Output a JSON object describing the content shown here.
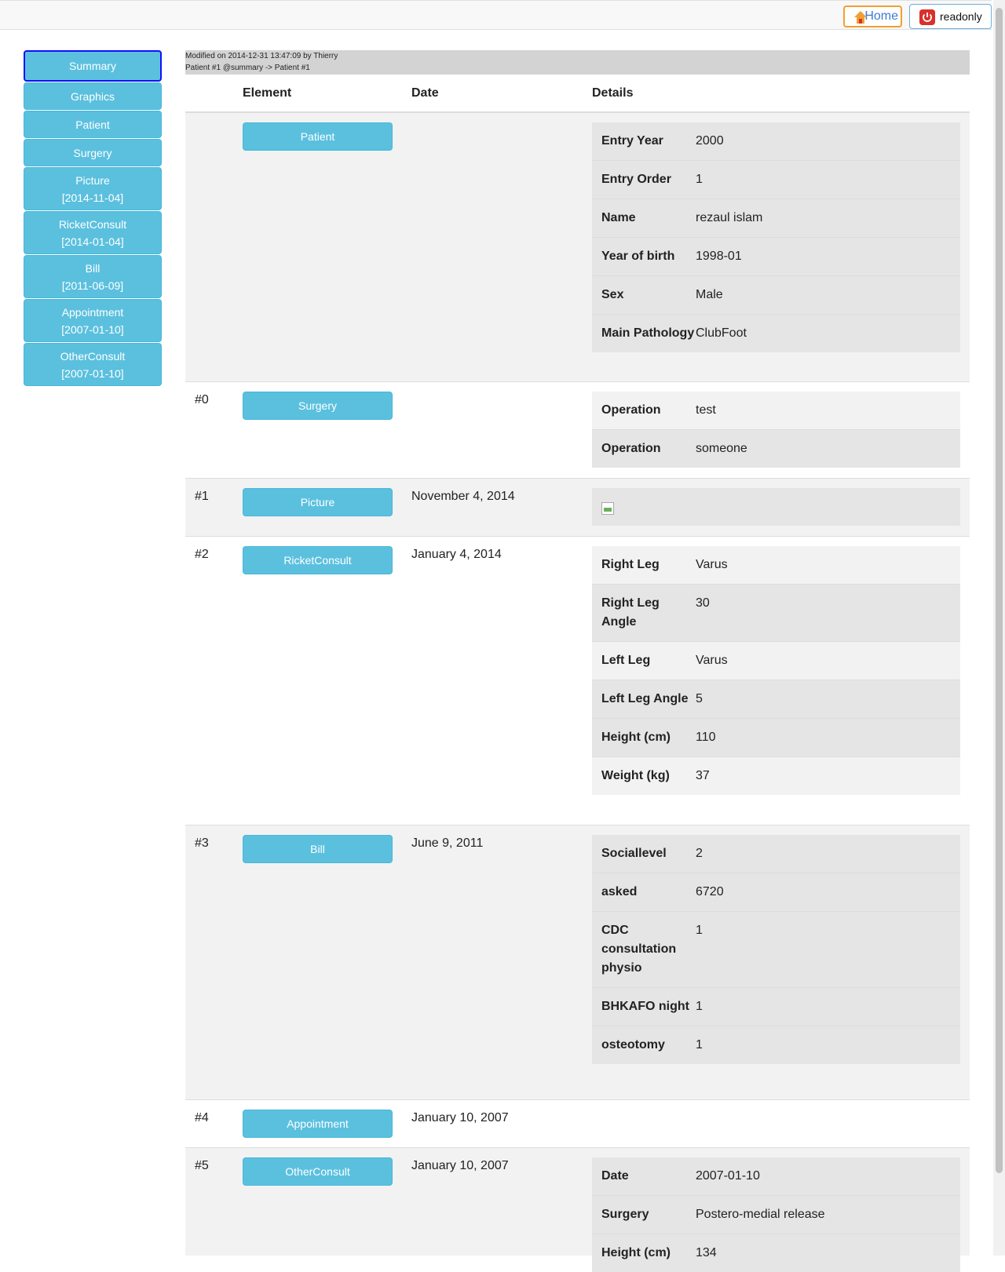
{
  "topbar": {
    "home_label": "Home",
    "readonly_label": "readonly"
  },
  "sidebar": {
    "items": [
      {
        "label": "Summary",
        "date": ""
      },
      {
        "label": "Graphics",
        "date": ""
      },
      {
        "label": "Patient",
        "date": ""
      },
      {
        "label": "Surgery",
        "date": ""
      },
      {
        "label": "Picture",
        "date": "[2014-11-04]"
      },
      {
        "label": "RicketConsult",
        "date": "[2014-01-04]"
      },
      {
        "label": "Bill",
        "date": "[2011-06-09]"
      },
      {
        "label": "Appointment",
        "date": "[2007-01-10]"
      },
      {
        "label": "OtherConsult",
        "date": "[2007-01-10]"
      }
    ]
  },
  "info": {
    "modified": "Modified on 2014-12-31 13:47:09 by Thierry",
    "path": "Patient #1 @summary -> Patient #1"
  },
  "table": {
    "headers": {
      "element": "Element",
      "date": "Date",
      "details": "Details"
    },
    "rows": [
      {
        "num": "",
        "element": "Patient",
        "date": "",
        "details": [
          {
            "label": "Entry Year",
            "value": "2000"
          },
          {
            "label": "Entry Order",
            "value": "1"
          },
          {
            "label": "Name",
            "value": "rezaul islam"
          },
          {
            "label": "Year of birth",
            "value": "1998-01"
          },
          {
            "label": "Sex",
            "value": "Male"
          },
          {
            "label": "Main Pathology",
            "value": "ClubFoot"
          }
        ]
      },
      {
        "num": "#0",
        "element": "Surgery",
        "date": "",
        "details": [
          {
            "label": "Operation",
            "value": "test"
          },
          {
            "label": "Operation",
            "value": "someone"
          }
        ]
      },
      {
        "num": "#1",
        "element": "Picture",
        "date": "November 4, 2014",
        "details": []
      },
      {
        "num": "#2",
        "element": "RicketConsult",
        "date": "January 4, 2014",
        "details": [
          {
            "label": "Right Leg",
            "value": "Varus"
          },
          {
            "label": "Right Leg Angle",
            "value": "30"
          },
          {
            "label": "Left Leg",
            "value": "Varus"
          },
          {
            "label": "Left Leg Angle",
            "value": "5"
          },
          {
            "label": "Height (cm)",
            "value": "110"
          },
          {
            "label": "Weight (kg)",
            "value": "37"
          }
        ]
      },
      {
        "num": "#3",
        "element": "Bill",
        "date": "June 9, 2011",
        "details": [
          {
            "label": "Sociallevel",
            "value": "2"
          },
          {
            "label": "asked",
            "value": "6720"
          },
          {
            "label": "CDC consultation physio",
            "value": "1"
          },
          {
            "label": "BHKAFO night",
            "value": "1"
          },
          {
            "label": "osteotomy",
            "value": "1"
          }
        ]
      },
      {
        "num": "#4",
        "element": "Appointment",
        "date": "January 10, 2007",
        "details": []
      },
      {
        "num": "#5",
        "element": "OtherConsult",
        "date": "January 10, 2007",
        "details": [
          {
            "label": "Date",
            "value": "2007-01-10"
          },
          {
            "label": "Surgery",
            "value": "Postero-medial release"
          },
          {
            "label": "Height (cm)",
            "value": "134"
          }
        ]
      }
    ]
  }
}
